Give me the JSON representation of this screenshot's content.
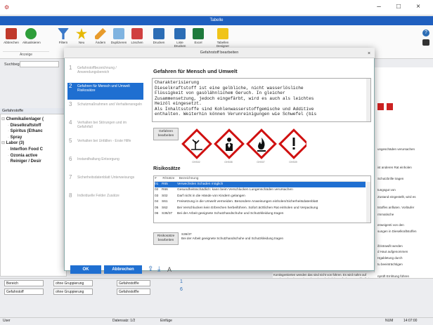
{
  "window": {
    "title": "Tabelle",
    "minimize": "–",
    "maximize": "□",
    "close": "×"
  },
  "ribbon": {
    "buttons": [
      "Abbrechen",
      "Aktualisieren",
      "Filtern",
      "Neu",
      "Ändern",
      "Duplizieren",
      "Löschen",
      "Drucken",
      "Liste Drucken",
      "Excel",
      "Tabellen Designer"
    ],
    "group_label": "Anzeige"
  },
  "search": {
    "label": "Suchbegriffe"
  },
  "left": {
    "header": "Gefahrstoffe",
    "tree": [
      {
        "label": "Chemikalienlager (",
        "bold": true,
        "level": 0
      },
      {
        "label": "Dieselkraftstoff",
        "bold": true,
        "level": 1
      },
      {
        "label": "Spiritus (Ethanc",
        "bold": true,
        "level": 1
      },
      {
        "label": "Spray",
        "bold": true,
        "level": 1
      },
      {
        "label": "Labor  (3)",
        "bold": true,
        "level": 0
      },
      {
        "label": "Interflon Food C",
        "bold": true,
        "level": 1
      },
      {
        "label": "Ozonia active",
        "bold": true,
        "level": 1
      },
      {
        "label": "Reiniger / Desir",
        "bold": true,
        "level": 1
      }
    ]
  },
  "right_texts": [
    "ungeschäden verursachen",
    "ist anderen Rat einholen",
    "Schutzbrille tragen",
    "tungsgut von",
    "Zustand eingestellt, wird es",
    "tstoffes anfluten. Vorläufer",
    "rmmatische",
    "erweigenti von den",
    "sungen in Dieselkraftstoffen",
    "ifzistrawfit werden",
    "d Haut aufgenommen",
    "Hgabletung durch",
    "tu beeinträchtigen",
    "nprüft Ernhtung führen",
    "ungeschädden verursachen"
  ],
  "bottom_text": "Kontingentierten wenden das sind nicht von führen. Es wird nahm auf Vorübergehende Beschwerden wie Schwindel, Kopfschmerzen, Übelkeit Konzentrationsstörungen können auftreten.",
  "filters": [
    {
      "label": "Bereich",
      "op": "ohne Gruppierung",
      "field": "Gefahrstoff/e"
    },
    {
      "label": "Gefahrstoff",
      "op": "ohne Gruppierung",
      "field": "Gefahrstoff/e"
    }
  ],
  "counters": [
    "1",
    "6"
  ],
  "status": {
    "left": "User",
    "mid": "Datensatz: 1/2",
    "mid2": "Einfüge",
    "right1": "NUM",
    "right2": "14:07:00"
  },
  "dialog": {
    "title": "Gefahrstoff bearbeiten",
    "steps": [
      {
        "num": "1",
        "label": "Gefahrstoffbezeichnung / Anwendungsbereich"
      },
      {
        "num": "2",
        "label": "Gefahren für Mensch und Umwelt Risikosätze"
      },
      {
        "num": "3",
        "label": "Schutzmaßnahmen und Verhaltensregeln"
      },
      {
        "num": "4",
        "label": "Verhalten bei Störungen und im Gefahrfall"
      },
      {
        "num": "5",
        "label": "Verhalten bei Unfällen - Erste Hilfe"
      },
      {
        "num": "6",
        "label": "Instandhaltung Entsorgung"
      },
      {
        "num": "7",
        "label": "Sicherheitsdatenblatt Unterweisungs"
      },
      {
        "num": "8",
        "label": "Individuelle Felder Zusätze"
      }
    ],
    "section_title": "Gefahren für Mensch und Umwelt",
    "text_lines": [
      "Charakterisierung",
      "Dieselkraftstoff ist eine gelbliche, nicht wasserlösliche",
      "Flüssigkeit von gasölähnlichem Geruch. In gleicher",
      "Zusammensetzung, jedoch eingefärbt, wird es auch als leichtes",
      "Heizöl eingesetzt.",
      "Als Inhaltsstoffe sind Kohlenwasserstoffgemische und Additive",
      "enthalten. Weiterhin können Verunreinigungen wie Schwefel (bis"
    ],
    "edit_hazards_button": "Gefahren bearbeiten",
    "ghs": [
      "GHS02",
      "GHS08",
      "GHS07",
      "GHS09"
    ],
    "risk_title": "Risikosätze",
    "risk_headers": [
      "#",
      "R/Sätze",
      "Bezeichnung"
    ],
    "risks": [
      {
        "n": "01",
        "code": "R65",
        "desc": "Verwechslen Schaden möglich",
        "sel": true
      },
      {
        "n": "02",
        "code": "R66",
        "desc": "Gesundheitsschädlich: kann beim Verschlucken Lungenschäden verursachen",
        "sel": false
      },
      {
        "n": "03",
        "code": "S02",
        "desc": "Darf nicht in die Hände von Kindern gelangen",
        "sel": false
      },
      {
        "n": "04",
        "code": "S61",
        "desc": "Freisetzung in die Umwelt vermeiden. Besondere Anweisungen einholen/Sicherheitsdatenblatt",
        "sel": false
      },
      {
        "n": "05",
        "code": "S62",
        "desc": "Bei Verschlucken kein Erbrechen herbeiführen. Sofort ärztlichen Rat einholen und Verpackung",
        "sel": false
      },
      {
        "n": "06",
        "code": "S36/37",
        "desc": "Bei der Arbeit geeignete Schutzhandschuhe und Schutzkleidung tragen",
        "sel": false
      }
    ],
    "edit_risks_button": "Risikosätze bearbeiten",
    "risk_detail_code": "S36/37",
    "risk_detail_desc": "Bei der Arbeit geeignete Schutzhandschuhe und Schutzkleidung tragen",
    "ok": "OK",
    "cancel": "Abbrechen"
  }
}
